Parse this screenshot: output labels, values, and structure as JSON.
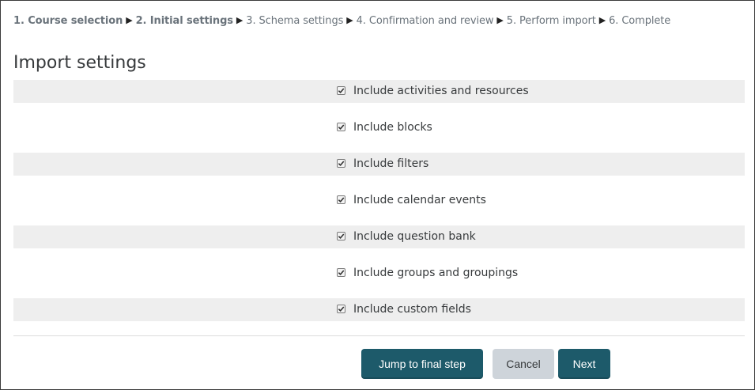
{
  "breadcrumb": [
    {
      "label": "1. Course selection",
      "done": true
    },
    {
      "label": "2. Initial settings",
      "done": true
    },
    {
      "label": "3. Schema settings",
      "done": false
    },
    {
      "label": "4. Confirmation and review",
      "done": false
    },
    {
      "label": "5. Perform import",
      "done": false
    },
    {
      "label": "6. Complete",
      "done": false
    }
  ],
  "separator": "▶",
  "title": "Import settings",
  "settings": [
    {
      "label": "Include activities and resources",
      "checked": true
    },
    {
      "label": "Include blocks",
      "checked": true
    },
    {
      "label": "Include filters",
      "checked": true
    },
    {
      "label": "Include calendar events",
      "checked": true
    },
    {
      "label": "Include question bank",
      "checked": true
    },
    {
      "label": "Include groups and groupings",
      "checked": true
    },
    {
      "label": "Include custom fields",
      "checked": true
    }
  ],
  "buttons": {
    "jump": "Jump to final step",
    "cancel": "Cancel",
    "next": "Next"
  },
  "colors": {
    "primary": "#1d5a6a",
    "secondary": "#ced4da",
    "row_shade": "#eeeeee"
  }
}
